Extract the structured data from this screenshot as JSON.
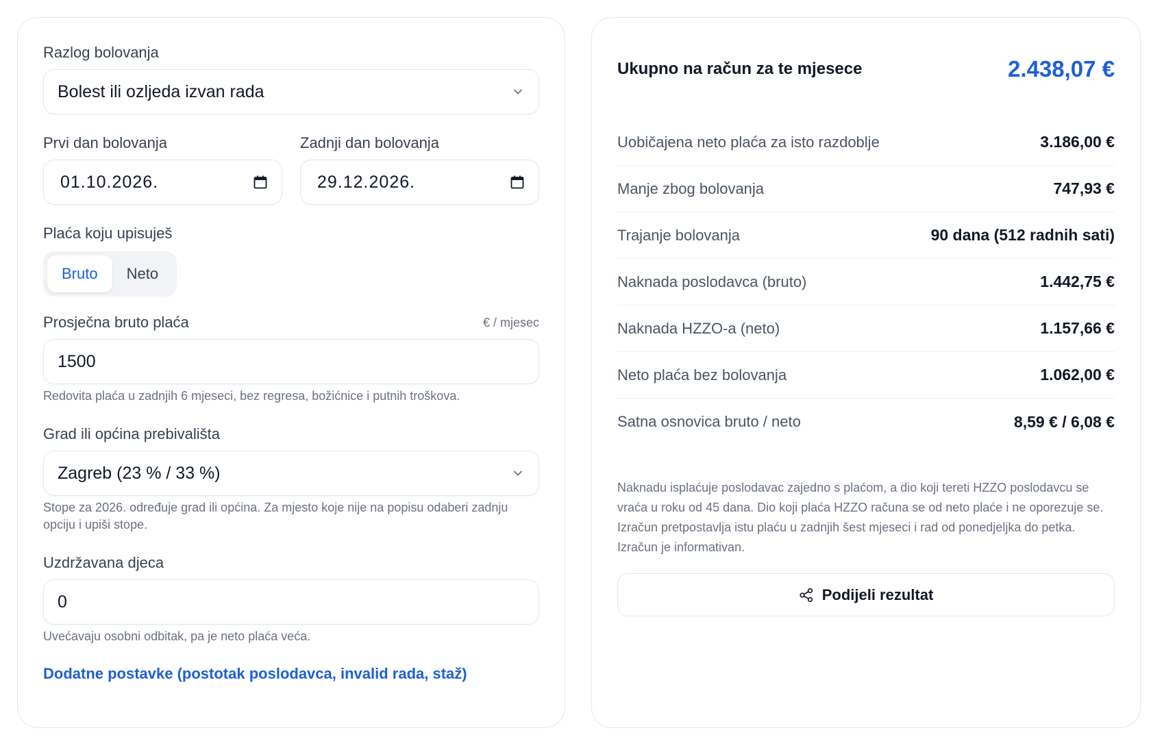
{
  "form": {
    "reason": {
      "label": "Razlog bolovanja",
      "value": "Bolest ili ozljeda izvan rada"
    },
    "first_day": {
      "label": "Prvi dan bolovanja",
      "value": "01.10.2026."
    },
    "last_day": {
      "label": "Zadnji dan bolovanja",
      "value": "29.12.2026."
    },
    "salary_type": {
      "label": "Plaća koju upisuješ",
      "options": [
        "Bruto",
        "Neto"
      ],
      "selected": "Bruto"
    },
    "avg_salary": {
      "label": "Prosječna bruto plaća",
      "unit": "€ / mjesec",
      "value": "1500",
      "help": "Redovita plaća u zadnjih 6 mjeseci, bez regresa, božićnice i putnih troškova."
    },
    "city": {
      "label": "Grad ili općina prebivališta",
      "value": "Zagreb (23 % / 33 %)",
      "help": "Stope za 2026. određuje grad ili općina. Za mjesto koje nije na popisu odaberi zadnju opciju i upiši stope."
    },
    "children": {
      "label": "Uzdržavana djeca",
      "value": "0",
      "help": "Uvećavaju osobni odbitak, pa je neto plaća veća."
    },
    "advanced_link": "Dodatne postavke (postotak poslodavca, invalid rada, staž)"
  },
  "results": {
    "total_label": "Ukupno na račun za te mjesece",
    "total_value": "2.438,07 €",
    "rows": [
      {
        "label": "Uobičajena neto plaća za isto razdoblje",
        "value": "3.186,00 €"
      },
      {
        "label": "Manje zbog bolovanja",
        "value": "747,93 €"
      },
      {
        "label": "Trajanje bolovanja",
        "value": "90 dana (512 radnih sati)"
      },
      {
        "label": "Naknada poslodavca (bruto)",
        "value": "1.442,75 €"
      },
      {
        "label": "Naknada HZZO-a (neto)",
        "value": "1.157,66 €"
      },
      {
        "label": "Neto plaća bez bolovanja",
        "value": "1.062,00 €"
      },
      {
        "label": "Satna osnovica bruto / neto",
        "value": "8,59 € / 6,08 €"
      }
    ],
    "note": "Naknadu isplaćuje poslodavac zajedno s plaćom, a dio koji tereti HZZO poslodavcu se vraća u roku od 45 dana. Dio koji plaća HZZO računa se od neto plaće i ne oporezuje se. Izračun pretpostavlja istu plaću u zadnjih šest mjeseci i rad od ponedjeljka do petka. Izračun je informativan.",
    "share_label": "Podijeli rezultat"
  },
  "icons": {
    "select": "chevron-down-icon",
    "date": "calendar-icon",
    "share": "share-icon"
  },
  "colors": {
    "accent": "#1d5fd6",
    "border": "#e5e7eb",
    "muted": "#6b7280"
  }
}
